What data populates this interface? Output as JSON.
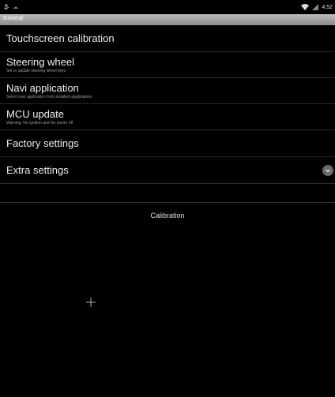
{
  "status_bar": {
    "time": "4:52",
    "icons": [
      "usb-icon",
      "android-debug-icon",
      "wifi-icon",
      "signal-icon"
    ]
  },
  "title_bar": {
    "title": "General"
  },
  "settings": {
    "items": [
      {
        "title": "Touchscreen calibration",
        "subtitle": ""
      },
      {
        "title": "Steering wheel",
        "subtitle": "Set or update steering wheel keys"
      },
      {
        "title": "Navi application",
        "subtitle": "Select navi application from installed applications"
      },
      {
        "title": "MCU update",
        "subtitle": "Warning: No ignition and No power off"
      },
      {
        "title": "Factory settings",
        "subtitle": ""
      },
      {
        "title": "Extra settings",
        "subtitle": ""
      }
    ]
  },
  "calibration": {
    "title": "Calibration"
  }
}
